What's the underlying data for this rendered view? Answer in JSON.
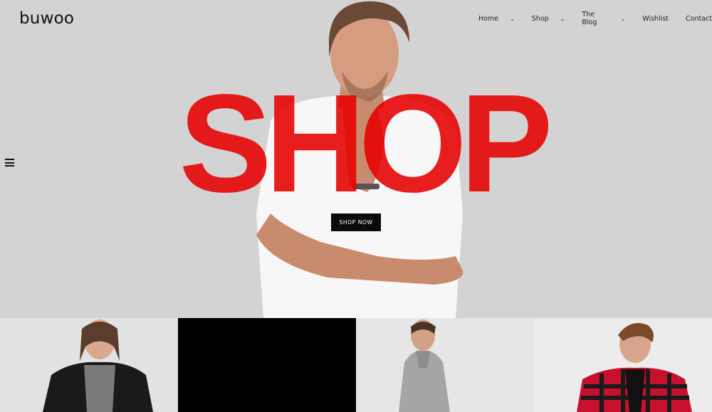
{
  "brand": {
    "logo": "buwoo"
  },
  "nav": {
    "items": [
      {
        "label": "Home",
        "has_dropdown": true
      },
      {
        "label": "Shop",
        "has_dropdown": true
      },
      {
        "label": "The Blog",
        "has_dropdown": true
      },
      {
        "label": "Wishlist",
        "has_dropdown": false
      },
      {
        "label": "Contact",
        "has_dropdown": false
      }
    ]
  },
  "hero": {
    "headline": "SHOP",
    "cta_label": "SHOP NOW",
    "headline_color": "#e60000",
    "background_color": "#d3d3d3"
  },
  "products": [
    {
      "name": "model-black-jacket"
    },
    {
      "name": "black-tile"
    },
    {
      "name": "model-grey-hoodie"
    },
    {
      "name": "model-plaid-hoodie"
    }
  ],
  "icons": {
    "menu": "hamburger-icon",
    "dropdown": "chevron-down-icon"
  }
}
